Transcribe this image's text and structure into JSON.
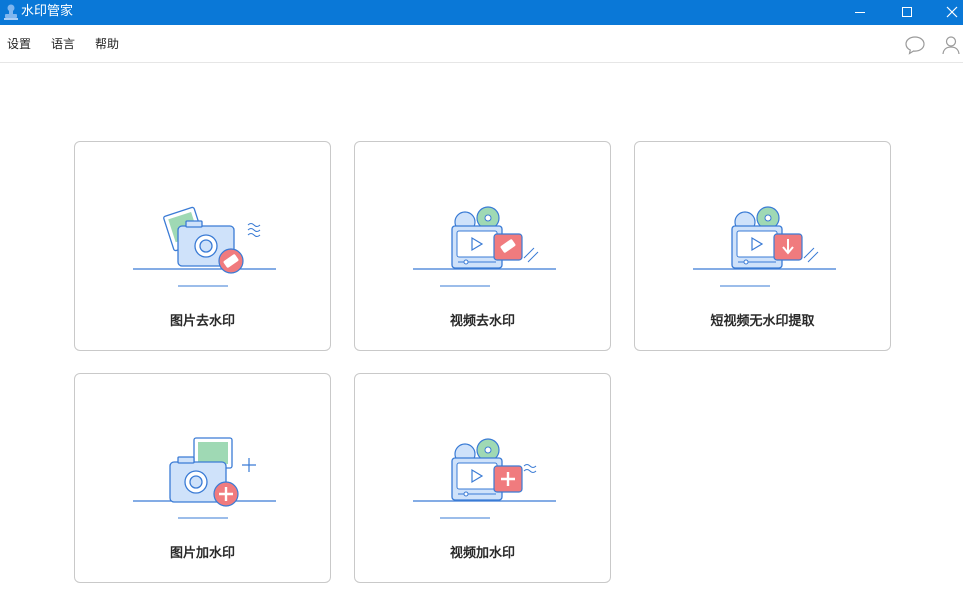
{
  "window": {
    "title": "水印管家",
    "icons": {
      "app": "stamp-icon",
      "minimize": "minimize-icon",
      "maximize": "maximize-icon",
      "close": "close-icon"
    }
  },
  "menu": {
    "items": [
      "设置",
      "语言",
      "帮助"
    ],
    "right_icons": [
      "chat-bubble-icon",
      "user-icon"
    ]
  },
  "features": [
    {
      "label": "图片去水印",
      "icon": "camera-eraser-icon"
    },
    {
      "label": "视频去水印",
      "icon": "video-eraser-icon"
    },
    {
      "label": "短视频无水印提取",
      "icon": "video-download-icon"
    },
    {
      "label": "图片加水印",
      "icon": "camera-add-icon"
    },
    {
      "label": "视频加水印",
      "icon": "video-add-icon"
    }
  ],
  "colors": {
    "titlebar": "#0a78d7",
    "accent_blue": "#3a7bd5",
    "light_blue": "#cfe2fa",
    "green": "#9fd9b4",
    "red_badge": "#f07b7e"
  }
}
